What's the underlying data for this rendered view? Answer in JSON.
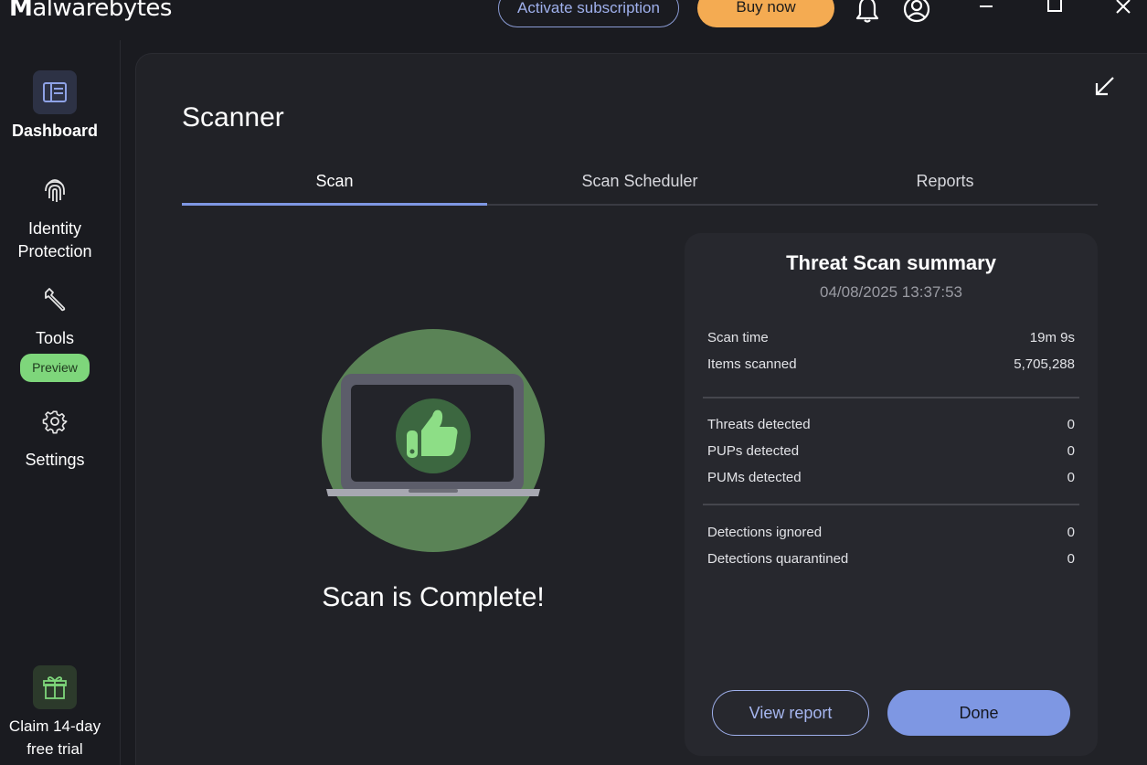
{
  "app": {
    "logo_first": "M",
    "logo_rest": "alwarebytes"
  },
  "header": {
    "activate_label": "Activate subscription",
    "buy_label": "Buy now"
  },
  "sidebar": {
    "items": [
      {
        "label": "Dashboard"
      },
      {
        "label": "Identity Protection"
      },
      {
        "label": "Tools",
        "badge": "Preview"
      },
      {
        "label": "Settings"
      }
    ],
    "trial_label": "Claim 14-day free trial"
  },
  "main": {
    "title": "Scanner",
    "tabs": [
      {
        "label": "Scan"
      },
      {
        "label": "Scan Scheduler"
      },
      {
        "label": "Reports"
      }
    ],
    "status": "Scan is Complete!"
  },
  "summary": {
    "title": "Threat Scan summary",
    "date": "04/08/2025 13:37:53",
    "rows": [
      {
        "label": "Scan time",
        "value": "19m 9s"
      },
      {
        "label": "Items scanned",
        "value": "5,705,288"
      },
      {
        "label": "Threats detected",
        "value": "0"
      },
      {
        "label": "PUPs detected",
        "value": "0"
      },
      {
        "label": "PUMs detected",
        "value": "0"
      },
      {
        "label": "Detections ignored",
        "value": "0"
      },
      {
        "label": "Detections quarantined",
        "value": "0"
      }
    ],
    "view_report_label": "View report",
    "done_label": "Done"
  },
  "colors": {
    "accent": "#7e97e3",
    "buy": "#f4ab52",
    "success": "#7ed67b",
    "background": "#1a1b20",
    "panel": "#212227",
    "card": "#27282e"
  },
  "icons": [
    "bell-icon",
    "account-icon",
    "minimize-icon",
    "maximize-icon",
    "close-icon",
    "dashboard-icon",
    "fingerprint-icon",
    "wrench-icon",
    "gear-icon",
    "gift-icon",
    "collapse-icon",
    "thumbs-up-icon"
  ]
}
